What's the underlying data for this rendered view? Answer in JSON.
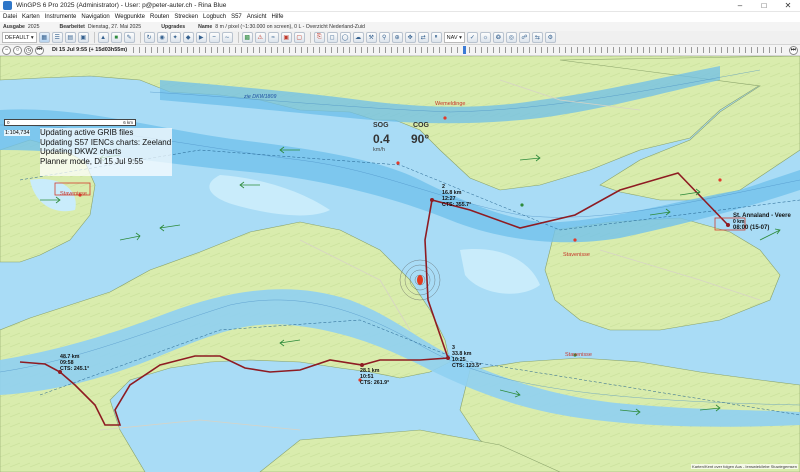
{
  "window": {
    "title": "WinGPS 6 Pro 2025 (Administrator) - User: p@peter-auter.ch - Rina Blue"
  },
  "menu": [
    "Datei",
    "Karten",
    "Instrumente",
    "Navigation",
    "Wegpunkte",
    "Routen",
    "Strecken",
    "Logbuch",
    "S57",
    "Ansicht",
    "Hilfe"
  ],
  "infobar": {
    "ausgabe_label": "Ausgabe",
    "ausgabe_value": "2025",
    "bearbeitet_label": "Bearbeitet",
    "bearbeitet_value": "Dienstag, 27. Mai 2025",
    "updates_label": "Upgrades",
    "name_label": "Name",
    "name_value": "8 m / pixel (~1:30.000 on screen), 0 L - Overzicht Nederland-Zuid"
  },
  "toolbar": {
    "profile": "DEFAULT",
    "nav_select": "NAV"
  },
  "timebar": {
    "time": "Di 15 Jul 9:55",
    "offset": "(+ 15d03h55m)"
  },
  "scale": {
    "ratio": "1:104,734",
    "bar_start": "0",
    "bar_end": "6 km"
  },
  "status_messages": [
    "Updating active GRIB files",
    "Updating S57 IENCs charts: Zeeland",
    "Updating DKW2 charts",
    "Planner mode, Di 15 Jul 9:55"
  ],
  "instruments": {
    "sog_label": "SOG",
    "sog_value": "0.4",
    "sog_unit": "km/h",
    "cog_label": "COG",
    "cog_value": "90°"
  },
  "route_labels": [
    {
      "line1": "2",
      "line2": "16.8 km",
      "line3": "12:27",
      "line4": "CTS: 355.7°"
    },
    {
      "line1": "3",
      "line2": "33.8 km",
      "line3": "10:25",
      "line4": "CTS: 123.5°"
    },
    {
      "line1": "",
      "line2": "28.1 km",
      "line3": "10:51",
      "line4": "CTS: 261.9°"
    },
    {
      "line1": "",
      "line2": "48.7 km",
      "line3": "09:58",
      "line4": "CTS: 245.1°"
    }
  ],
  "destination": {
    "name": "St. Annaland - Veere",
    "sub": "0 km",
    "arrival": "08:00 (15-07)"
  },
  "places": [
    "Stavenisse",
    "Stavenisse",
    "Wemeldinge",
    "Stavenisse"
  ],
  "chart_text": {
    "area_name": "zie DKW1809"
  },
  "footer": "Karten/Kent over folgen Aus - Ienswiek/lebe Stuwiegemsen"
}
